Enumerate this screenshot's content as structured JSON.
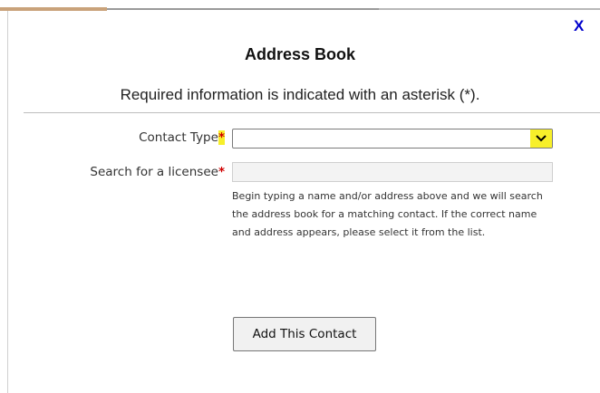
{
  "dialog": {
    "close_label": "X",
    "title": "Address Book",
    "required_note": "Required information is indicated with an asterisk (*)."
  },
  "form": {
    "contact_type": {
      "label": "Contact Type",
      "asterisk": "*",
      "selected_value": ""
    },
    "search_licensee": {
      "label": "Search for a licensee",
      "asterisk": "*",
      "value": "",
      "help_text": "Begin typing a name and/or address above and we will search the address book for a matching contact. If the correct name and address appears, please select it from the list."
    },
    "submit_label": "Add This Contact"
  },
  "colors": {
    "close_x": "#0000cc",
    "asterisk": "#d00000",
    "highlight": "#f7ef2a"
  }
}
